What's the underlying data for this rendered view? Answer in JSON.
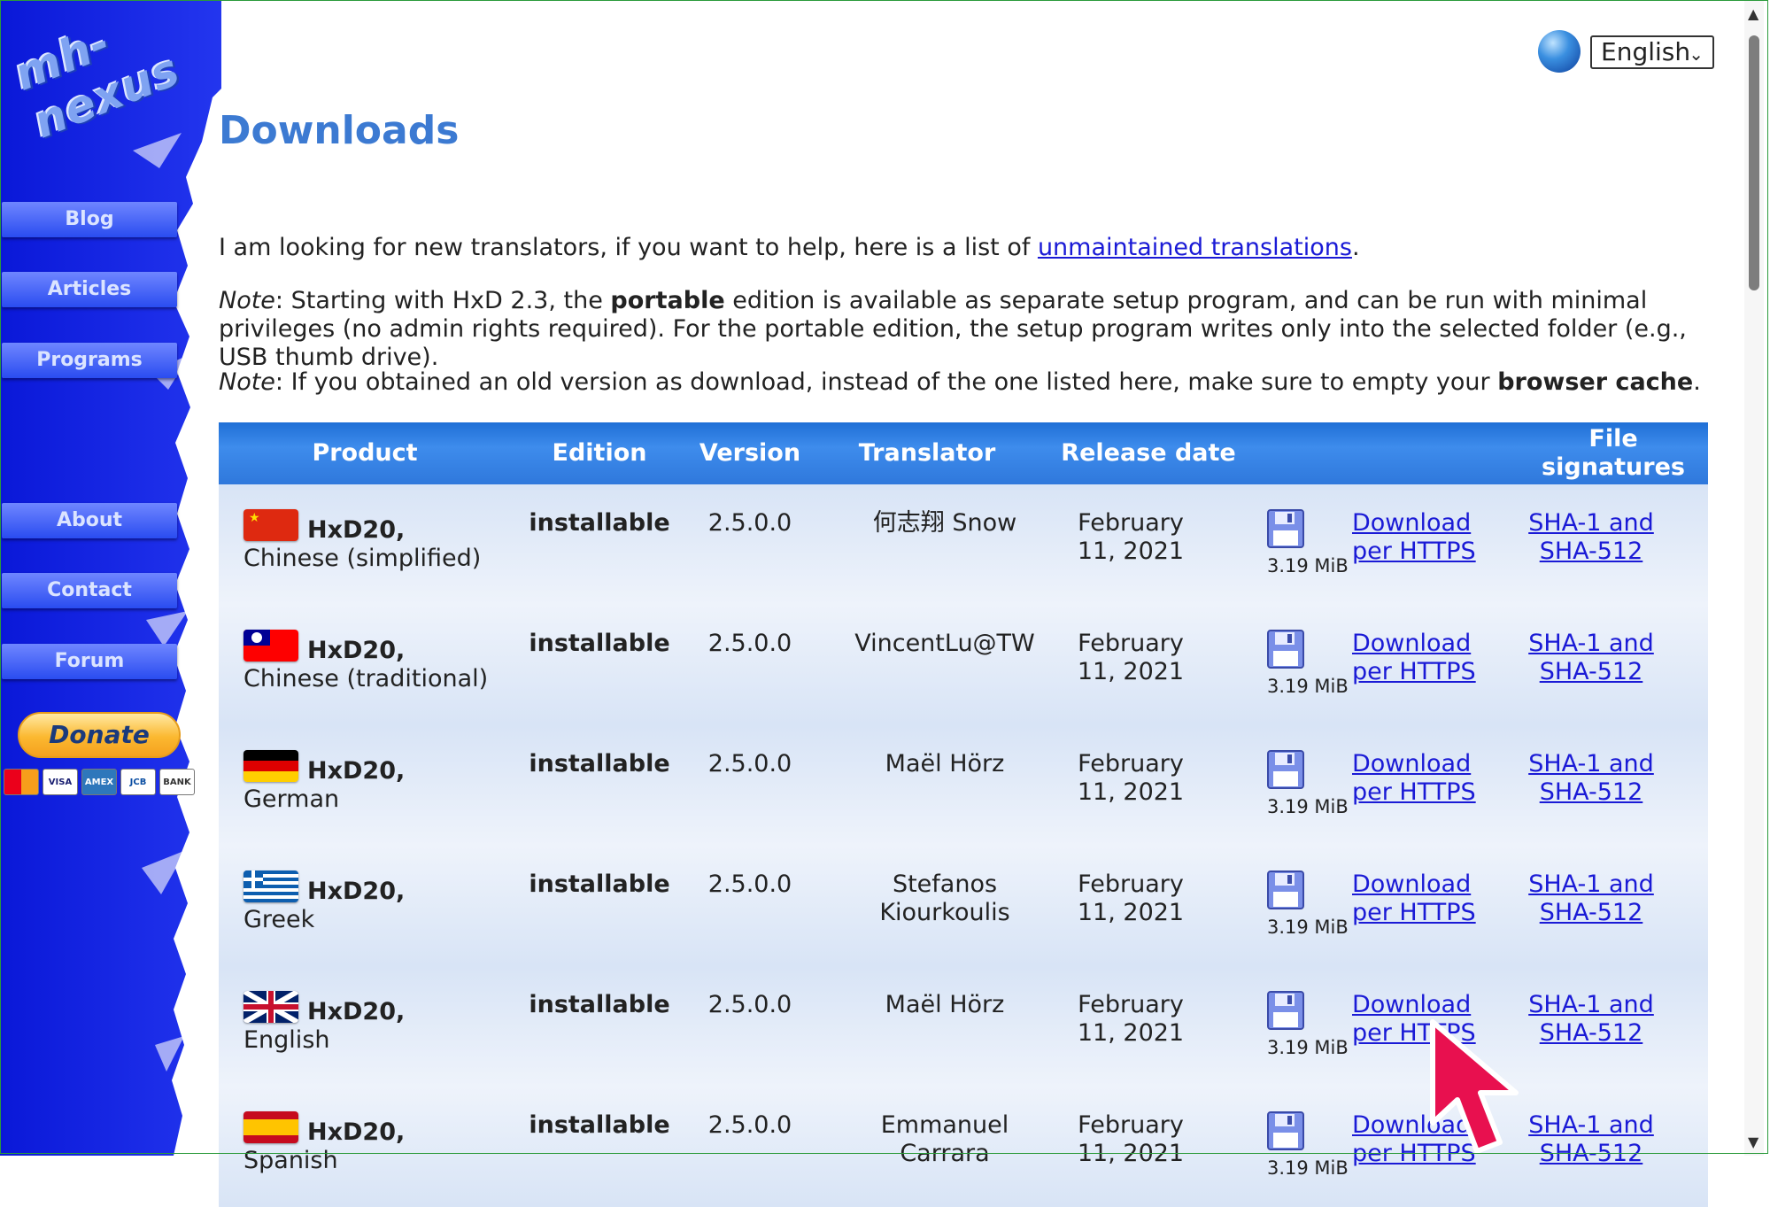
{
  "brand": "mh-nexus",
  "nav": [
    {
      "label": "Blog"
    },
    {
      "label": "Articles"
    },
    {
      "label": "Programs"
    },
    {
      "label": "About"
    },
    {
      "label": "Contact"
    },
    {
      "label": "Forum"
    }
  ],
  "donate_label": "Donate",
  "cards": [
    "MasterCard",
    "VISA",
    "AMEX",
    "JCB",
    "BANK"
  ],
  "language": {
    "selected": "English"
  },
  "page_title": "Downloads",
  "intro": {
    "text_before": "I am looking for new translators, if you want to help, here is a list of ",
    "link": "unmaintained translations",
    "text_after": "."
  },
  "note1": {
    "label": "Note",
    "t1": ": Starting with HxD 2.3, the ",
    "bold": "portable",
    "t2": " edition is available as separate setup program, and can be run with minimal privileges (no admin rights required). For the portable edition, the setup program writes only into the selected folder (e.g., USB thumb drive)."
  },
  "note2": {
    "label": "Note",
    "t1": ": If you obtained an old version as download, instead of the one listed here, make sure to empty your ",
    "bold": "browser cache",
    "t2": "."
  },
  "table": {
    "headers": {
      "product": "Product",
      "edition": "Edition",
      "version": "Version",
      "translator": "Translator",
      "release": "Release date",
      "signatures": "File signatures"
    },
    "rows": [
      {
        "flag": "cn",
        "product": "HxD20,",
        "language": "Chinese (simplified)",
        "edition": "installable",
        "version": "2.5.0.0",
        "translator": "何志翔 Snow",
        "date": "February 11, 2021",
        "size": "3.19 MiB",
        "download": "Download per HTTPS",
        "sig": "SHA-1 and SHA-512"
      },
      {
        "flag": "tw",
        "product": "HxD20,",
        "language": "Chinese (traditional)",
        "edition": "installable",
        "version": "2.5.0.0",
        "translator": "VincentLu@TW",
        "date": "February 11, 2021",
        "size": "3.19 MiB",
        "download": "Download per HTTPS",
        "sig": "SHA-1 and SHA-512"
      },
      {
        "flag": "de",
        "product": "HxD20,",
        "language": "German",
        "edition": "installable",
        "version": "2.5.0.0",
        "translator": "Maël Hörz",
        "date": "February 11, 2021",
        "size": "3.19 MiB",
        "download": "Download per HTTPS",
        "sig": "SHA-1 and SHA-512"
      },
      {
        "flag": "gr",
        "product": "HxD20,",
        "language": "Greek",
        "edition": "installable",
        "version": "2.5.0.0",
        "translator": "Stefanos Kiourkoulis",
        "date": "February 11, 2021",
        "size": "3.19 MiB",
        "download": "Download per HTTPS",
        "sig": "SHA-1 and SHA-512"
      },
      {
        "flag": "gb",
        "product": "HxD20,",
        "language": "English",
        "edition": "installable",
        "version": "2.5.0.0",
        "translator": "Maël Hörz",
        "date": "February 11, 2021",
        "size": "3.19 MiB",
        "download": "Download per HTTPS",
        "sig": "SHA-1 and SHA-512"
      },
      {
        "flag": "es",
        "product": "HxD20,",
        "language": "Spanish",
        "edition": "installable",
        "version": "2.5.0.0",
        "translator": "Emmanuel Carrara",
        "date": "February 11, 2021",
        "size": "3.19 MiB",
        "download": "Download per HTTPS",
        "sig": "SHA-1 and SHA-512"
      }
    ]
  },
  "colors": {
    "title": "#3c7ad2",
    "header": "#2f78dc",
    "link": "#1a1ad6",
    "sidebar": "#1a2ef0",
    "cursor": "#e8104f"
  }
}
